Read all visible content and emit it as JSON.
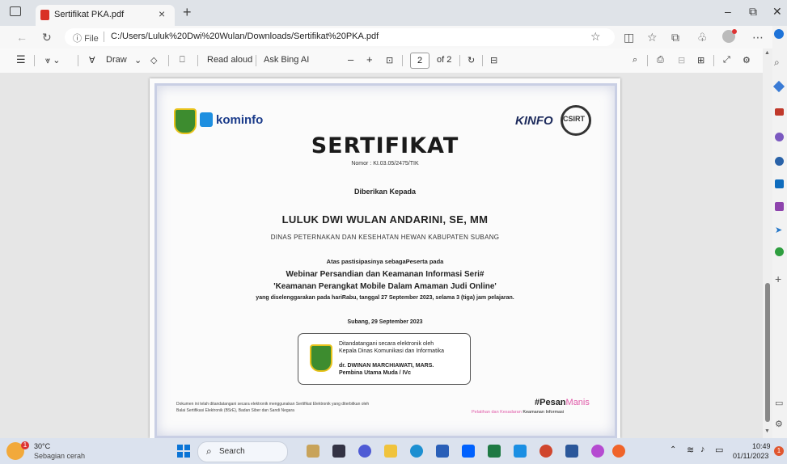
{
  "browser": {
    "tab_title": "Sertifikat PKA.pdf",
    "tab_close": "×",
    "new_tab": "+",
    "minimize": "–",
    "restore": "⧉",
    "close": "✕",
    "address_prefix": "File",
    "url": "C:/Users/Luluk%20Dwi%20Wulan/Downloads/Sertifikat%20PKA.pdf"
  },
  "pdf_toolbar": {
    "draw": "Draw",
    "read_aloud": "Read aloud",
    "ask_ai": "Ask Bing AI",
    "zoom_out": "–",
    "zoom_in": "+",
    "page_current": "2",
    "page_total": "of 2"
  },
  "certificate": {
    "title": "SERTIFIKAT",
    "nomor": "Nomor : KI.03.05/2475/TIK",
    "diberikan": "Diberikan Kepada",
    "recipient": "LULUK DWI WULAN ANDARINI, SE, MM",
    "agency": "DINAS PETERNAKAN DAN KESEHATAN HEWAN KABUPATEN SUBANG",
    "atas": "Atas pastisipasinya sebagaPeserta pada",
    "webinar": "Webinar Persandian dan Keamanan Informasi Seri#",
    "topic": "'Keamanan Perangkat Mobile Dalam Amaman Judi Online'",
    "details": "yang diselenggarakan pada hariRabu, tanggal 27 September 2023, selama 3 (tiga) jam pelajaran.",
    "place_date": "Subang, 29 September 2023",
    "signed_line1": "Ditandatangani secara elektronik oleh",
    "signed_line2": "Kepala Dinas Komunikasi dan Informatika",
    "signer": "dr. DWINAN MARCHIAWATI, MARS.",
    "rank": "Pembina Utama Muda / IVc",
    "footer1": "Dokumen ini telah ditandatangani secara elektronik menggunakan Sertifikat Elektronik yang diterbitkan oleh",
    "footer2": "Balai Sertifikasi Elektronik (BSrE), Badan Siber dan Sandi Negara",
    "hashtag_a": "#Pesan",
    "hashtag_b": "Manis",
    "tagline_a": "Pelatihan dan Kesadaran ",
    "tagline_b": "Keamanan Informasi",
    "logo_kominfo": "kominfo",
    "logo_kinfo": "KINFO",
    "logo_csirt": "CSIRT"
  },
  "taskbar": {
    "temp": "30°C",
    "weather": "Sebagian cerah",
    "search": "Search",
    "time": "10:49",
    "date": "01/11/2023",
    "notif": "1"
  },
  "colors": {
    "accent": "#0067c0",
    "cert_title": "#1a1a1a",
    "cert_border": "#b8bfd8",
    "magenta": "#e05aa8"
  }
}
